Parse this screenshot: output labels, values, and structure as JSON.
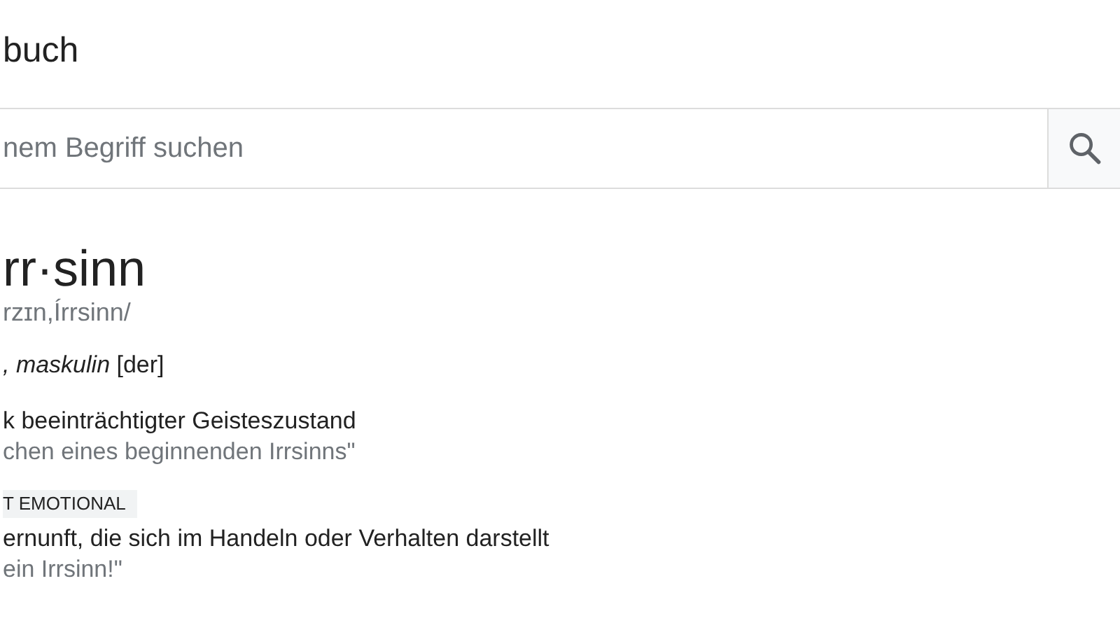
{
  "title": "buch",
  "search": {
    "placeholder": "nem Begriff suchen"
  },
  "entry": {
    "headword": "rr·sinn",
    "pronunciation": "rzɪn,Írrsinn/",
    "grammar": "*, maskulin* [der]",
    "senses": [
      {
        "definition": "k beeinträchtigter Geisteszustand",
        "example": "chen eines beginnenden Irrsinns\""
      },
      {
        "tag": "T EMOTIONAL",
        "definition": "ernunft, die sich im Handeln oder Verhalten darstellt",
        "example": "ein Irrsinn!\""
      }
    ]
  }
}
